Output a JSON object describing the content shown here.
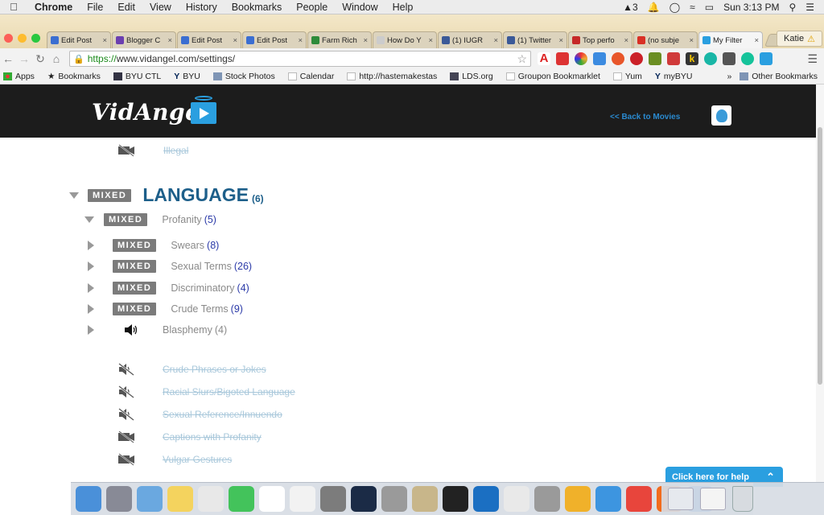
{
  "menubar": {
    "app": "Chrome",
    "items": [
      "File",
      "Edit",
      "View",
      "History",
      "Bookmarks",
      "People",
      "Window",
      "Help"
    ],
    "status_badge": "3",
    "clock": "Sun 3:13 PM"
  },
  "browser": {
    "tabs": [
      {
        "title": "Edit Post",
        "color": "#3b6ed1"
      },
      {
        "title": "Blogger C",
        "color": "#6b3fb0"
      },
      {
        "title": "Edit Post",
        "color": "#3b6ed1"
      },
      {
        "title": "Edit Post",
        "color": "#3b6ed1"
      },
      {
        "title": "Farm Rich",
        "color": "#2e8b3a"
      },
      {
        "title": "How Do Y",
        "color": "#cccccc"
      },
      {
        "title": "(1) IUGR",
        "color": "#3b5998"
      },
      {
        "title": "(1) Twitter",
        "color": "#3b5998"
      },
      {
        "title": "Top perfo",
        "color": "#c62828"
      },
      {
        "title": "(no subje",
        "color": "#d93025"
      },
      {
        "title": "My Filter",
        "color": "#2a9fe0"
      }
    ],
    "profile_name": "Katie",
    "url_scheme": "https://",
    "url_host": "www.vidangel.com",
    "url_path": "/settings/",
    "bookmarks": [
      "Apps",
      "Bookmarks",
      "BYU CTL",
      "BYU",
      "Stock Photos",
      "Calendar",
      "http://hastemakestas",
      "LDS.org",
      "Groupon Bookmarklet",
      "Yum",
      "myBYU"
    ],
    "bookmarks_overflow": "»",
    "other_bookmarks": "Other Bookmarks"
  },
  "site": {
    "logo": "VidAngel",
    "back_link": "<< Back to Movies"
  },
  "filters": {
    "illegal_label": "Illegal",
    "section": {
      "badge": "MIXED",
      "title": "LANGUAGE",
      "count": "(6)"
    },
    "profanity": {
      "badge": "MIXED",
      "label": "Profanity",
      "count": "(5)"
    },
    "subitems": [
      {
        "badge": "MIXED",
        "label": "Swears",
        "count": "(8)"
      },
      {
        "badge": "MIXED",
        "label": "Sexual Terms",
        "count": "(26)"
      },
      {
        "badge": "MIXED",
        "label": "Discriminatory",
        "count": "(4)"
      },
      {
        "badge": "MIXED",
        "label": "Crude Terms",
        "count": "(9)"
      }
    ],
    "blasphemy": {
      "label": "Blasphemy",
      "count": "(4)"
    },
    "muted_items": [
      "Crude Phrases or Jokes",
      "Racial Slurs/Bigoted Language",
      "Sexual Reference/Innuendo",
      "Captions with Profanity",
      "Vulgar Gestures"
    ]
  },
  "help": {
    "label": "Click here for help"
  },
  "dock_colors": [
    "#4a90d9",
    "#888a96",
    "#6aa8e0",
    "#f4d35e",
    "#e8e8e8",
    "#43c35b",
    "#ffffff",
    "#f2f2f2",
    "#7c7c7c",
    "#1b2b46",
    "#9a9a9a",
    "#c8b68a",
    "#222222",
    "#1b6fc2",
    "#e9e9e9",
    "#9a9a9a",
    "#f0b12a",
    "#3d95e0",
    "#e8453c",
    "#f26b1d",
    "#2f7de1"
  ]
}
